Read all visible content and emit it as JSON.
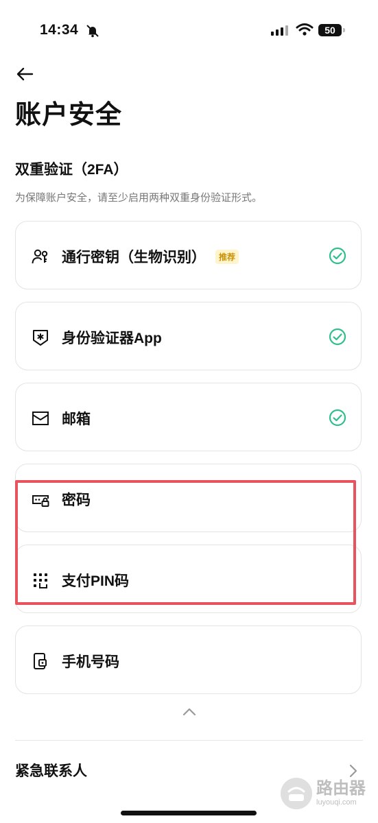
{
  "status_bar": {
    "time": "14:34",
    "battery": "50"
  },
  "header": {
    "title": "账户安全"
  },
  "two_fa": {
    "title": "双重验证（2FA）",
    "description": "为保障账户安全，请至少启用两种双重身份验证形式。",
    "items": [
      {
        "label": "通行密钥（生物识别）",
        "badge": "推荐",
        "icon": "passkey-users-icon",
        "enabled": true
      },
      {
        "label": "身份验证器App",
        "icon": "authenticator-shield-icon",
        "enabled": true
      },
      {
        "label": "邮箱",
        "icon": "mail-icon",
        "enabled": true
      },
      {
        "label": "密码",
        "icon": "password-lock-icon",
        "enabled": false
      },
      {
        "label": "支付PIN码",
        "icon": "pin-keypad-icon",
        "enabled": false
      },
      {
        "label": "手机号码",
        "icon": "phone-icon",
        "enabled": false
      }
    ]
  },
  "emergency": {
    "label": "紧急联系人"
  },
  "watermark": {
    "main": "路由器",
    "sub": "luyouqi.com"
  },
  "colors": {
    "check": "#2fbf8a",
    "highlight": "#e8545e",
    "badge_bg": "#fff4cc",
    "badge_text": "#c8920a"
  }
}
